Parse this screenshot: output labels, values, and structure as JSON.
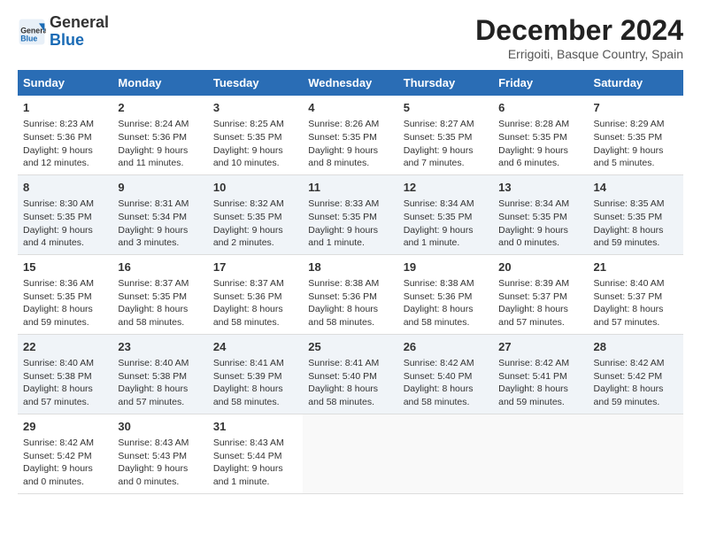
{
  "header": {
    "logo_general": "General",
    "logo_blue": "Blue",
    "month_title": "December 2024",
    "location": "Errigoiti, Basque Country, Spain"
  },
  "days_of_week": [
    "Sunday",
    "Monday",
    "Tuesday",
    "Wednesday",
    "Thursday",
    "Friday",
    "Saturday"
  ],
  "weeks": [
    [
      {
        "day": "1",
        "sunrise": "8:23 AM",
        "sunset": "5:36 PM",
        "daylight": "9 hours and 12 minutes."
      },
      {
        "day": "2",
        "sunrise": "8:24 AM",
        "sunset": "5:36 PM",
        "daylight": "9 hours and 11 minutes."
      },
      {
        "day": "3",
        "sunrise": "8:25 AM",
        "sunset": "5:35 PM",
        "daylight": "9 hours and 10 minutes."
      },
      {
        "day": "4",
        "sunrise": "8:26 AM",
        "sunset": "5:35 PM",
        "daylight": "9 hours and 8 minutes."
      },
      {
        "day": "5",
        "sunrise": "8:27 AM",
        "sunset": "5:35 PM",
        "daylight": "9 hours and 7 minutes."
      },
      {
        "day": "6",
        "sunrise": "8:28 AM",
        "sunset": "5:35 PM",
        "daylight": "9 hours and 6 minutes."
      },
      {
        "day": "7",
        "sunrise": "8:29 AM",
        "sunset": "5:35 PM",
        "daylight": "9 hours and 5 minutes."
      }
    ],
    [
      {
        "day": "8",
        "sunrise": "8:30 AM",
        "sunset": "5:35 PM",
        "daylight": "9 hours and 4 minutes."
      },
      {
        "day": "9",
        "sunrise": "8:31 AM",
        "sunset": "5:34 PM",
        "daylight": "9 hours and 3 minutes."
      },
      {
        "day": "10",
        "sunrise": "8:32 AM",
        "sunset": "5:35 PM",
        "daylight": "9 hours and 2 minutes."
      },
      {
        "day": "11",
        "sunrise": "8:33 AM",
        "sunset": "5:35 PM",
        "daylight": "9 hours and 1 minute."
      },
      {
        "day": "12",
        "sunrise": "8:34 AM",
        "sunset": "5:35 PM",
        "daylight": "9 hours and 1 minute."
      },
      {
        "day": "13",
        "sunrise": "8:34 AM",
        "sunset": "5:35 PM",
        "daylight": "9 hours and 0 minutes."
      },
      {
        "day": "14",
        "sunrise": "8:35 AM",
        "sunset": "5:35 PM",
        "daylight": "8 hours and 59 minutes."
      }
    ],
    [
      {
        "day": "15",
        "sunrise": "8:36 AM",
        "sunset": "5:35 PM",
        "daylight": "8 hours and 59 minutes."
      },
      {
        "day": "16",
        "sunrise": "8:37 AM",
        "sunset": "5:35 PM",
        "daylight": "8 hours and 58 minutes."
      },
      {
        "day": "17",
        "sunrise": "8:37 AM",
        "sunset": "5:36 PM",
        "daylight": "8 hours and 58 minutes."
      },
      {
        "day": "18",
        "sunrise": "8:38 AM",
        "sunset": "5:36 PM",
        "daylight": "8 hours and 58 minutes."
      },
      {
        "day": "19",
        "sunrise": "8:38 AM",
        "sunset": "5:36 PM",
        "daylight": "8 hours and 58 minutes."
      },
      {
        "day": "20",
        "sunrise": "8:39 AM",
        "sunset": "5:37 PM",
        "daylight": "8 hours and 57 minutes."
      },
      {
        "day": "21",
        "sunrise": "8:40 AM",
        "sunset": "5:37 PM",
        "daylight": "8 hours and 57 minutes."
      }
    ],
    [
      {
        "day": "22",
        "sunrise": "8:40 AM",
        "sunset": "5:38 PM",
        "daylight": "8 hours and 57 minutes."
      },
      {
        "day": "23",
        "sunrise": "8:40 AM",
        "sunset": "5:38 PM",
        "daylight": "8 hours and 57 minutes."
      },
      {
        "day": "24",
        "sunrise": "8:41 AM",
        "sunset": "5:39 PM",
        "daylight": "8 hours and 58 minutes."
      },
      {
        "day": "25",
        "sunrise": "8:41 AM",
        "sunset": "5:40 PM",
        "daylight": "8 hours and 58 minutes."
      },
      {
        "day": "26",
        "sunrise": "8:42 AM",
        "sunset": "5:40 PM",
        "daylight": "8 hours and 58 minutes."
      },
      {
        "day": "27",
        "sunrise": "8:42 AM",
        "sunset": "5:41 PM",
        "daylight": "8 hours and 59 minutes."
      },
      {
        "day": "28",
        "sunrise": "8:42 AM",
        "sunset": "5:42 PM",
        "daylight": "8 hours and 59 minutes."
      }
    ],
    [
      {
        "day": "29",
        "sunrise": "8:42 AM",
        "sunset": "5:42 PM",
        "daylight": "9 hours and 0 minutes."
      },
      {
        "day": "30",
        "sunrise": "8:43 AM",
        "sunset": "5:43 PM",
        "daylight": "9 hours and 0 minutes."
      },
      {
        "day": "31",
        "sunrise": "8:43 AM",
        "sunset": "5:44 PM",
        "daylight": "9 hours and 1 minute."
      },
      null,
      null,
      null,
      null
    ]
  ]
}
